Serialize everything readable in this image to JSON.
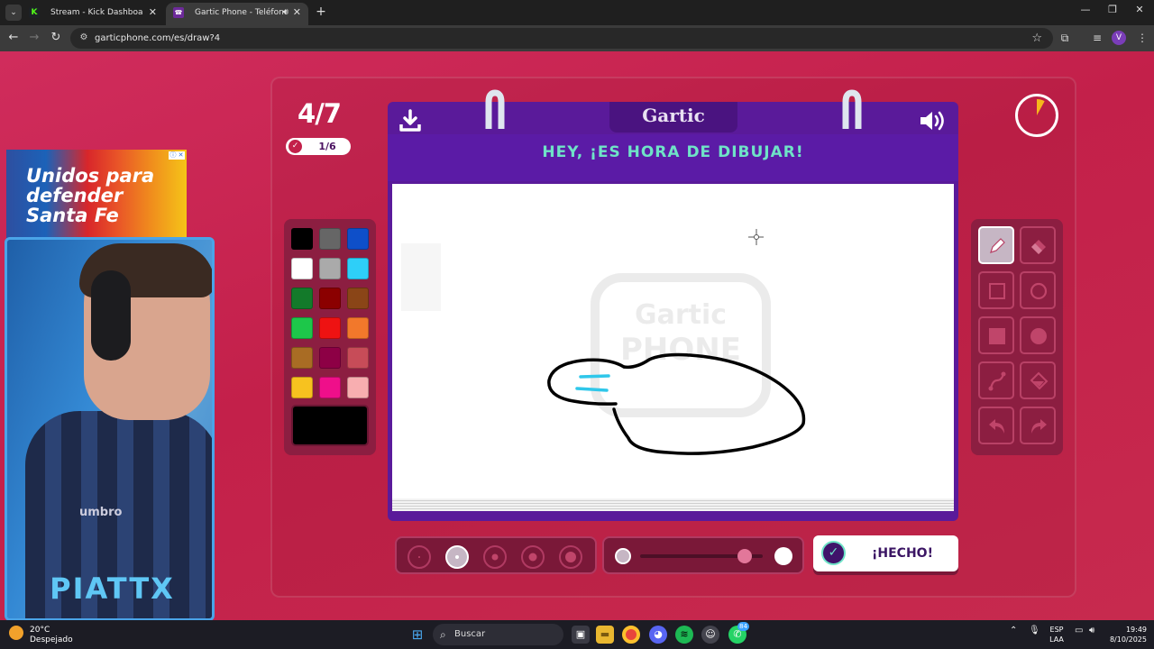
{
  "browser": {
    "tabs": [
      {
        "label": "Stream - Kick Dashboard",
        "favicon": "K"
      },
      {
        "label": "Gartic Phone - Teléfono De",
        "favicon": "☎"
      }
    ],
    "url": "garticphone.com/es/draw?4",
    "profile_initial": "V"
  },
  "game": {
    "round": "4/7",
    "done_count": "1/6",
    "brand": "Gartic",
    "heading": "HEY, ¡ES HORA DE DIBUJAR!",
    "watermark_top": "Gartic",
    "watermark_bottom": "PHONE",
    "done_button": "¡HECHO!",
    "timer_elapsed_fraction": 0.08,
    "selected_brush_size": 2,
    "opacity_level": 0.85,
    "selected_tool": "pencil",
    "palette": [
      "#000000",
      "#666666",
      "#0e4fc9",
      "#ffffff",
      "#aaaaaa",
      "#2ecff8",
      "#137a2a",
      "#8b0000",
      "#8a4517",
      "#1dc74a",
      "#ee1212",
      "#f2782b",
      "#a96c24",
      "#8d0045",
      "#c74c58",
      "#f7c21f",
      "#ef0f8a",
      "#f8aeb0"
    ],
    "current_color": "#000000",
    "tools": [
      "pencil",
      "eraser",
      "rectangle-outline",
      "circle-outline",
      "rectangle-filled",
      "circle-filled",
      "line",
      "fill-bucket",
      "undo",
      "redo"
    ]
  },
  "stream": {
    "ad_text": [
      "Unidos para",
      "defender",
      "Santa Fe"
    ],
    "ad_badge": "ⓘ ✕",
    "streamer_name": "PIATTX",
    "shirt_logo": "umbro"
  },
  "taskbar": {
    "temperature": "20°C",
    "weather": "Despejado",
    "search_label": "Buscar",
    "lang_top": "ESP",
    "lang_bottom": "LAA",
    "time": "19:49",
    "date": "8/10/2025",
    "badge": "84"
  },
  "colors": {
    "page_bg": "#c9264f",
    "paper_header": "#5a1a9a",
    "heading_text": "#6fe3c7",
    "panel": "#8c1e41"
  }
}
